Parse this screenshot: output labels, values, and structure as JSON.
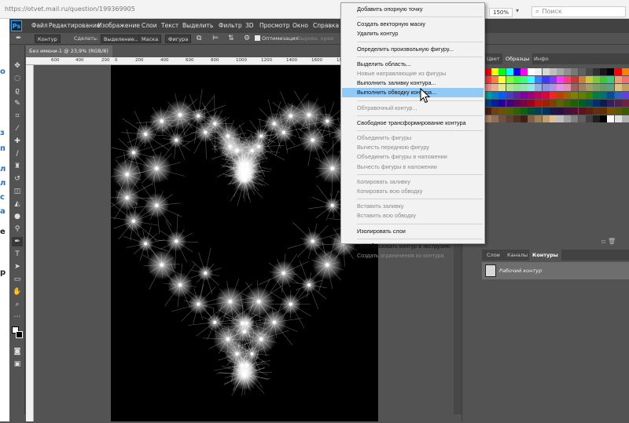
{
  "browser": {
    "url": "https://otvet.mail.ru/question/199369905",
    "zoom": "150%",
    "search_placeholder": "Поиск"
  },
  "page_left_letters": [
    "м",
    "о",
    "з",
    "п",
    "л",
    "л",
    "с",
    "а",
    "е",
    "р"
  ],
  "menubar": {
    "logo": "Ps",
    "items": [
      "Файл",
      "Редактирование",
      "Изображение",
      "Слои",
      "Текст",
      "Выделить",
      "Фильтр",
      "3D",
      "Просмотр",
      "Окно",
      "Справка"
    ]
  },
  "options": {
    "mode": "Контур",
    "make_label": "Сделать:",
    "selection": "Выделение...",
    "mask": "Маска",
    "shape": "Фигура",
    "optimize": "Оптимизация",
    "align_edges": "Выровн. края"
  },
  "document": {
    "tab_title": "Без имени-1 @ 23,9% (RGB/8) *",
    "close": "×",
    "ruler_ticks": [
      "600",
      "400",
      "200",
      "0",
      "200",
      "400",
      "600",
      "800",
      "1000",
      "1200",
      "1400",
      "1600",
      "1800",
      "2000"
    ]
  },
  "swatches_panel": {
    "tabs": [
      "Цвет",
      "Образцы",
      "Инфо"
    ],
    "active_tab": "Образцы",
    "rows": [
      [
        "#ff0000",
        "#ffff00",
        "#00ff00",
        "#00ffff",
        "#0000ff",
        "#ff00ff",
        "#ffffff",
        "#f0f0f0",
        "#d8d8d8",
        "#c0c0c0",
        "#a8a8a8",
        "#909090",
        "#787878",
        "#606060",
        "#484848",
        "#303030",
        "#181818",
        "#000000",
        "#ff0000",
        "#ff8000"
      ],
      [
        "#ff3a3a",
        "#ff7f3a",
        "#ffff3a",
        "#7fff3a",
        "#3aff3a",
        "#3aff7f",
        "#3affff",
        "#3a7fff",
        "#3a3aff",
        "#7f3aff",
        "#ff3aff",
        "#ff3a7f",
        "#c83a3a",
        "#c87f3a",
        "#c8c83a",
        "#7fc83a",
        "#3ac83a",
        "#3ac87f",
        "#f0a070",
        "#f07070"
      ],
      [
        "#e89090",
        "#e8b090",
        "#e8e890",
        "#b0e890",
        "#90e890",
        "#90e8b0",
        "#90e8e8",
        "#90b0e8",
        "#9090e8",
        "#b090e8",
        "#e890e8",
        "#e890b0",
        "#a06060",
        "#a08060",
        "#a0a060",
        "#80a060",
        "#60a060",
        "#60a080",
        "#e0c080",
        "#c0a060"
      ],
      [
        "#00a0a0",
        "#0080c0",
        "#0060ff",
        "#4040c0",
        "#6020a0",
        "#8000a0",
        "#a00080",
        "#c00060",
        "#e00040",
        "#ff2020",
        "#c04000",
        "#a06000",
        "#808000",
        "#608000",
        "#408000",
        "#008040",
        "#007070",
        "#005090",
        "#3060c0",
        "#6040e0"
      ],
      [
        "#004080",
        "#0020a0",
        "#2000a0",
        "#400080",
        "#600060",
        "#800040",
        "#a00020",
        "#c01010",
        "#a02000",
        "#804000",
        "#606000",
        "#406000",
        "#206000",
        "#006020",
        "#005050",
        "#003070",
        "#0c1c50",
        "#302060",
        "#502050",
        "#702040"
      ],
      [
        "#502010",
        "#704010",
        "#705000",
        "#506000",
        "#306000",
        "#106010",
        "#005030",
        "#004050",
        "#003060",
        "#1a1a4a",
        "#2a1040",
        "#401040",
        "#501030",
        "#601020",
        "#602010",
        "#603010",
        "#603000",
        "#7a5000",
        "#5a5a00",
        "#3a5a00"
      ],
      [
        "#b08060",
        "#907050",
        "#705040",
        "#604030",
        "#503020",
        "#402010",
        "#806040",
        "#a08050",
        "#c0a070",
        "#e0c090",
        "#c0c0c0",
        "#a0a0a0",
        "#808080",
        "#606060",
        "#404040",
        "#202020",
        "#000000",
        "#ffffff",
        "#e0e0e0",
        "#b0b0b0"
      ]
    ]
  },
  "paths_panel": {
    "tabs": [
      "Слои",
      "Каналы",
      "Контуры"
    ],
    "active_tab": "Контуры",
    "path_name": "Рабочий контур"
  },
  "context_menu": {
    "items": [
      {
        "label": "Добавить опорную точку",
        "enabled": true
      },
      {
        "sep": true
      },
      {
        "label": "Создать векторную маску",
        "enabled": true
      },
      {
        "label": "Удалить контур",
        "enabled": true
      },
      {
        "sep": true
      },
      {
        "label": "Определить произвольную фигуру...",
        "enabled": true
      },
      {
        "sep": true
      },
      {
        "label": "Выделить область...",
        "enabled": true
      },
      {
        "label": "Новые направляющие из фигуры",
        "enabled": false
      },
      {
        "label": "Выполнить заливку контура...",
        "enabled": true
      },
      {
        "label": "Выполнить обводку контура...",
        "enabled": true,
        "highlighted": true
      },
      {
        "sep": true
      },
      {
        "label": "Обтравочный контур...",
        "enabled": false
      },
      {
        "sep": true
      },
      {
        "label": "Свободное трансформирование контура",
        "enabled": true
      },
      {
        "sep": true
      },
      {
        "label": "Объединить фигуры",
        "enabled": false
      },
      {
        "label": "Вычесть переднюю фигуру",
        "enabled": false
      },
      {
        "label": "Объединить фигуры в наложении",
        "enabled": false
      },
      {
        "label": "Вычесть фигуры в наложении",
        "enabled": false
      },
      {
        "sep": true
      },
      {
        "label": "Копировать заливку",
        "enabled": false
      },
      {
        "label": "Копировать всю обводку",
        "enabled": false
      },
      {
        "sep": true
      },
      {
        "label": "Вставить заливку",
        "enabled": false
      },
      {
        "label": "Вставить всю обводку",
        "enabled": false
      },
      {
        "sep": true
      },
      {
        "label": "Изолировать слои",
        "enabled": true
      },
      {
        "sep": true
      },
      {
        "label": "Преобразовать контур в экструзию",
        "enabled": true
      },
      {
        "label": "Создать ограничения из контура",
        "enabled": false
      }
    ]
  },
  "colors": {
    "menu_highlight": "#91c9f7",
    "ps_accent": "#3ea6f3"
  }
}
